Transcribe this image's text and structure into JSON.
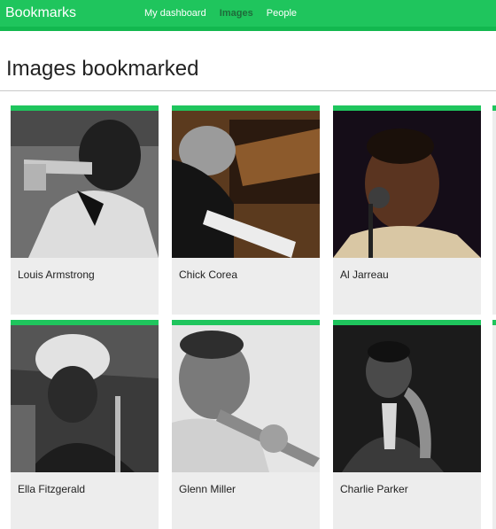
{
  "header": {
    "brand": "Bookmarks",
    "nav": [
      {
        "label": "My dashboard",
        "active": false
      },
      {
        "label": "Images",
        "active": true
      },
      {
        "label": "People",
        "active": false
      }
    ],
    "accent_color": "#1fc55d"
  },
  "page": {
    "title": "Images bookmarked"
  },
  "cards": [
    {
      "name": "Louis Armstrong"
    },
    {
      "name": "Chick Corea"
    },
    {
      "name": "Al Jarreau"
    },
    {
      "name": "Ella Fitzgerald"
    },
    {
      "name": "Glenn Miller"
    },
    {
      "name": "Charlie Parker"
    }
  ]
}
